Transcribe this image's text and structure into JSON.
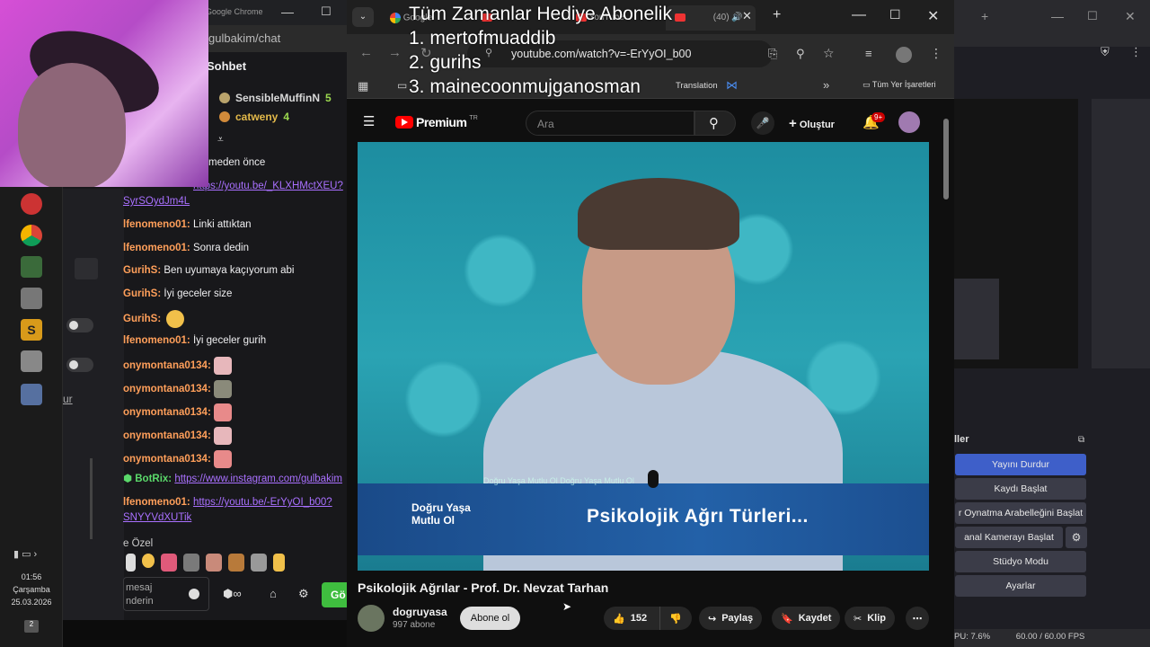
{
  "overlay": {
    "gift_title": "Tüm Zamanlar Hediye Abonelik",
    "gift_list": [
      "1. mertofmuaddib",
      "2. gurihs",
      "3. mainecoonmujganosman"
    ]
  },
  "taskbar": {
    "time": "01:56",
    "day": "Çarşamba",
    "date": "25.03.2026",
    "notification_count": "2"
  },
  "chat": {
    "window_title": "Google Chrome",
    "address": "gulbakim/chat",
    "header": "Sohbet",
    "viewers": [
      {
        "name": "SensibleMuffinN",
        "count": "5"
      },
      {
        "name": "catweny",
        "count": "4"
      }
    ],
    "partial_line": "meden önce",
    "messages": [
      {
        "user": "...",
        "text": "",
        "link": "https://youtu.be/_KLXHMctXEU?",
        "link2": "SyrSOydJm4L"
      },
      {
        "user": "lfenomeno01:",
        "text": "Linki attıktan"
      },
      {
        "user": "lfenomeno01:",
        "text": "Sonra dedin"
      },
      {
        "user": "GurihS:",
        "text": "Ben uyumaya kaçıyorum abi"
      },
      {
        "user": "GurihS:",
        "text": "İyi geceler size"
      },
      {
        "user": "GurihS:",
        "text": ""
      },
      {
        "user": "lfenomeno01:",
        "text": "İyi geceler gurih"
      },
      {
        "user": "onymontana0134:",
        "text": ""
      },
      {
        "user": "onymontana0134:",
        "text": ""
      },
      {
        "user": "onymontana0134:",
        "text": ""
      },
      {
        "user": "onymontana0134:",
        "text": ""
      },
      {
        "user": "onymontana0134:",
        "text": ""
      },
      {
        "user": "BotRix:",
        "text": "",
        "link": "https://www.instagram.com/gulbakim"
      },
      {
        "user": "lfenomeno01:",
        "text": "",
        "link": "https://youtu.be/-ErYyOI_b00?",
        "link2": "SNYYVdXUTik"
      }
    ],
    "private_label": "e Özel",
    "input_placeholder_1": "mesaj",
    "input_placeholder_2": "nderin",
    "send_label": "Gö",
    "left_col_text": "ur"
  },
  "browser": {
    "url": "youtube.com/watch?v=-ErYyOI_b00",
    "tabs": [
      "Google",
      "",
      "YouTube",
      "(40)"
    ],
    "bookmarks": [
      "Translation",
      "Tüm Yer İşaretleri"
    ]
  },
  "youtube": {
    "logo": "Premium",
    "logo_suffix": "TR",
    "search_placeholder": "Ara",
    "create_label": "Oluştur",
    "notif_badge": "9+",
    "video_banner": "Psikolojik Ağrı Türleri...",
    "video_logo": "Doğru Yaşa Mutlu Ol",
    "video_ticker": "Doğru Yaşa Mutlu Ol   Doğru Yaşa Mutlu Ol",
    "title": "Psikolojik Ağrılar - Prof. Dr. Nevzat Tarhan",
    "channel": "dogruyasa",
    "subs": "997 abone",
    "subscribe": "Abone ol",
    "likes": "152",
    "share": "Paylaş",
    "save": "Kaydet",
    "clip": "Klip"
  },
  "obs": {
    "controls_title": "ller",
    "buttons": [
      {
        "label": "Yayını Durdur",
        "active": true
      },
      {
        "label": "Kaydı Başlat"
      },
      {
        "label": "r Oynatma Arabelleğini Başlat"
      },
      {
        "label": "anal Kamerayı Başlat"
      },
      {
        "label": "Stüdyo Modu"
      },
      {
        "label": "Ayarlar"
      }
    ],
    "status_cpu": "PU: 7.6%",
    "status_fps": "60.00 / 60.00 FPS"
  },
  "colors": {
    "twitch_purple": "#a970ff",
    "youtube_red": "#ff0000",
    "obs_active": "#3e5fc9"
  }
}
